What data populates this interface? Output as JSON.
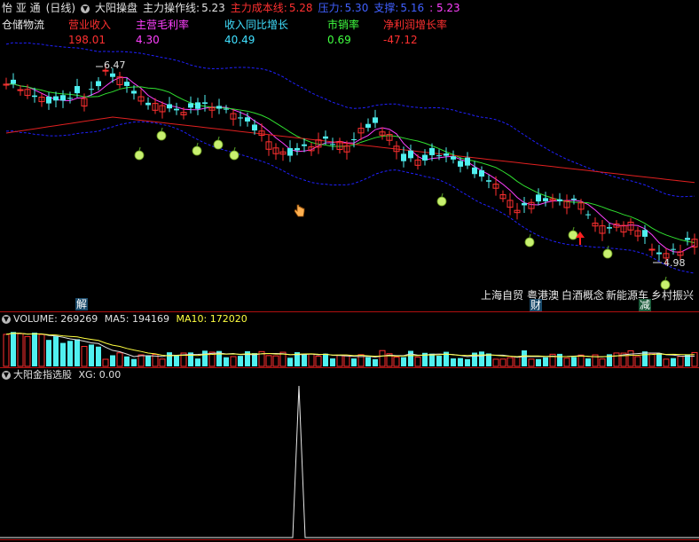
{
  "header": {
    "app_title": "怡 亚 通",
    "period": "(日线)",
    "indicator_name": "大阳操盘",
    "main_op_label": "主力操作线:",
    "main_op_value": "5.23",
    "cost_label": "主力成本线:",
    "cost_value": "5.28",
    "pressure_label": "压力:",
    "pressure_value": "5.30",
    "support_label": "支撑:",
    "support_value": "5.16",
    "extra_value": ": 5.23"
  },
  "financials": {
    "sector": "仓储物流",
    "items": [
      {
        "label": "营业收入",
        "value": "198.01",
        "color": "#ff3030"
      },
      {
        "label": "主营毛利率",
        "value": "4.30",
        "color": "#ff40ff"
      },
      {
        "label": "收入同比增长",
        "value": "40.49",
        "color": "#40e0ff"
      },
      {
        "label": "市销率",
        "value": "0.69",
        "color": "#40ff40"
      },
      {
        "label": "净利润增长率",
        "value": "-47.12",
        "color": "#ff3030"
      }
    ]
  },
  "annotations": {
    "high_price": "6.47",
    "low_price": "4.98"
  },
  "concepts": {
    "items": [
      "上海自贸",
      "粤港澳",
      "白酒概念",
      "新能源车",
      "乡村振兴"
    ],
    "tag_left": "解",
    "tag_mid": "财",
    "tag_right": "减"
  },
  "volume_panel": {
    "label": "VOLUME:",
    "value": "269269",
    "ma5_label": "MA5:",
    "ma5_value": "194169",
    "ma10_label": "MA10:",
    "ma10_value": "172020"
  },
  "signal_panel": {
    "title": "大阳金指选股",
    "xg_label": "XG:",
    "xg_value": "0.00"
  },
  "colors": {
    "up": "#ff3030",
    "down": "#50f0f0",
    "ma_short": "#ff40ff",
    "ma_mid": "#30e030",
    "ma_long": "#e02020",
    "band": "#2020ff",
    "ma10": "#ffff40"
  }
}
